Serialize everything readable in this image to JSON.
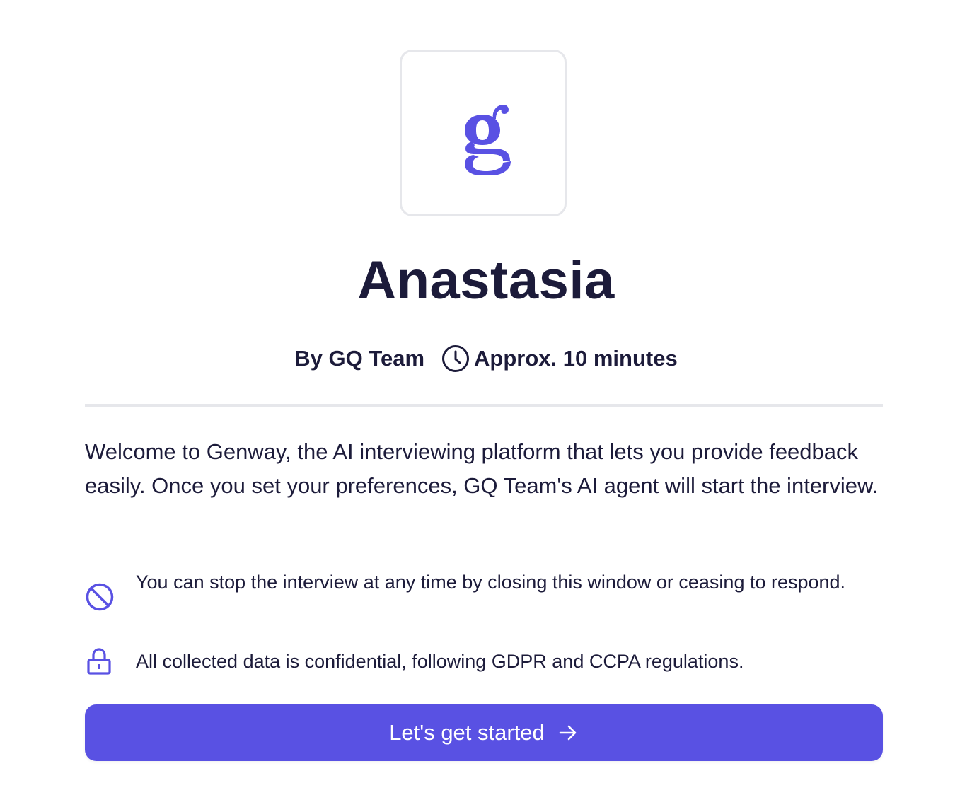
{
  "logo": {
    "icon": "genway-g-logo-icon",
    "brand_color": "#5951e3"
  },
  "survey": {
    "title": "Anastasia",
    "author": "By GQ Team",
    "duration": "Approx. 10 minutes",
    "duration_icon": "clock-icon"
  },
  "intro": {
    "text": "Welcome to Genway, the AI interviewing platform that lets you provide feedback easily. Once you set your preferences, GQ Team's AI agent will start the interview."
  },
  "notices": [
    {
      "icon": "prohibited-icon",
      "text": "You can stop the interview at any time by closing this window or ceasing to respond."
    },
    {
      "icon": "lock-icon",
      "text": "All collected data is confidential, following GDPR and CCPA regulations."
    }
  ],
  "cta": {
    "label": "Let's get started",
    "icon": "arrow-right-icon",
    "color": "#5951e3"
  },
  "colors": {
    "text": "#1c1b3a",
    "accent": "#5951e3",
    "divider": "#e6e7eb"
  }
}
